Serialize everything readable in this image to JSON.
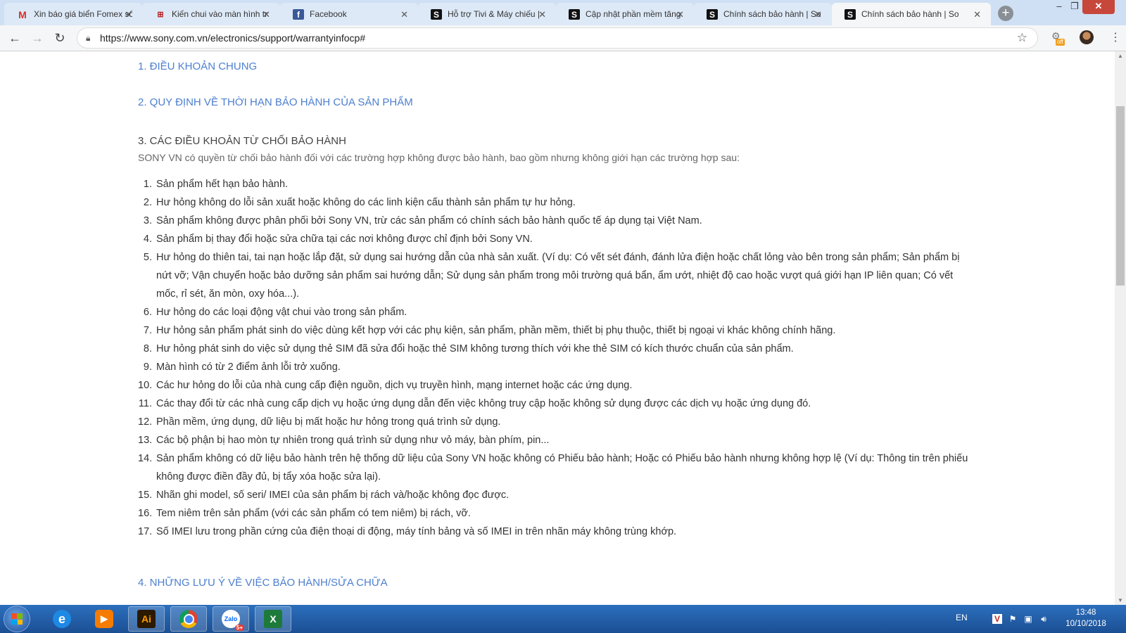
{
  "browser": {
    "tabs": [
      {
        "title": "Xin báo giá biển Fomex sổ",
        "favicon": "gmail-icon"
      },
      {
        "title": "Kiến chui vào màn hình tr",
        "favicon": "kienthuc-icon"
      },
      {
        "title": "Facebook",
        "favicon": "facebook-icon"
      },
      {
        "title": "Hỗ trợ Tivi & Máy chiếu |",
        "favicon": "sony-icon"
      },
      {
        "title": "Cập nhật phần mềm tăng",
        "favicon": "sony-icon"
      },
      {
        "title": "Chính sách bảo hành | So",
        "favicon": "sony-icon"
      },
      {
        "title": "Chính sách bảo hành | So",
        "favicon": "sony-icon",
        "active": true
      }
    ],
    "url": "https://www.sony.com.vn/electronics/support/warrantyinfocp#",
    "extension_badge": "off"
  },
  "page": {
    "section1": "1. ĐIỀU KHOẢN CHUNG",
    "section2": "2. QUY ĐỊNH VỀ THỜI HẠN BẢO HÀNH CỦA SẢN PHẨM",
    "section3": "3. CÁC ĐIỀU KHOẢN TỪ CHỐI BẢO HÀNH",
    "intro": "SONY VN có quyền từ chối bảo hành đối với các trường hợp không được bảo hành, bao gồm nhưng không giới hạn các trường hợp sau:",
    "items": [
      {
        "num": "1.",
        "text": "Sản phẩm hết hạn bảo hành."
      },
      {
        "num": "2.",
        "text": "Hư hỏng không do lỗi sản xuất hoặc không do các linh kiện cấu thành sản phẩm tự hư hỏng."
      },
      {
        "num": "3.",
        "text": "Sản phẩm không được phân phối bởi Sony VN, trừ các sản phẩm có chính sách bảo hành quốc tế áp dụng tại Việt Nam."
      },
      {
        "num": "4.",
        "text": "Sản phẩm bị thay đổi hoặc sửa chữa tại các nơi không được chỉ định bởi Sony VN."
      },
      {
        "num": "5.",
        "text": "Hư hỏng do thiên tai, tai nạn hoặc lắp đặt, sử dụng sai hướng dẫn của nhà sản xuất. (Ví dụ: Có vết sét đánh, đánh lửa điện hoặc chất lỏng vào bên trong sản phẩm; Sản phẩm bị nứt vỡ; Vận chuyển hoặc bảo dưỡng sản phẩm sai hướng dẫn; Sử dụng sản phẩm trong môi trường quá bẩn, ẩm ướt, nhiệt độ cao hoặc vượt quá giới hạn IP liên quan; Có vết mốc, rỉ sét, ăn mòn, oxy hóa...)."
      },
      {
        "num": "6.",
        "text": "Hư hỏng do các loại động vật chui vào trong sản phẩm."
      },
      {
        "num": "7.",
        "text": "Hư hỏng sản phẩm phát sinh do việc dùng kết hợp với các phụ kiện, sản phẩm, phần mềm, thiết bị phụ thuộc, thiết bị ngoại vi khác không chính hãng."
      },
      {
        "num": "8.",
        "text": "Hư hỏng phát sinh do việc sử dụng thẻ SIM đã sửa đổi hoặc thẻ SIM không tương thích với khe thẻ SIM có kích thước chuẩn của sản phẩm."
      },
      {
        "num": "9.",
        "text": "Màn hình có từ 2 điểm ảnh lỗi trở xuống."
      },
      {
        "num": "10.",
        "text": "Các hư hỏng do lỗi của nhà cung cấp điện nguồn, dịch vụ truyền hình, mạng internet hoặc các ứng dụng."
      },
      {
        "num": "11.",
        "text": "Các thay đổi từ các nhà cung cấp dịch vụ hoặc ứng dụng dẫn đến việc không truy cập hoặc không sử dụng được các dịch vụ hoặc ứng dụng đó."
      },
      {
        "num": "12.",
        "text": "Phần mềm, ứng dụng, dữ liệu bị mất hoặc hư hỏng trong quá trình sử dụng."
      },
      {
        "num": "13.",
        "text": "Các bộ phận bị hao mòn tự nhiên trong quá trình sử dụng như vỏ máy, bàn phím, pin..."
      },
      {
        "num": "14.",
        "text": "Sản phẩm không có dữ liệu bảo hành trên hệ thống dữ liệu của Sony VN hoặc không có Phiếu bảo hành; Hoặc có Phiếu bảo hành nhưng không hợp lệ (Ví dụ: Thông tin trên phiếu không được điền đầy đủ, bị tẩy xóa hoặc sửa lại)."
      },
      {
        "num": "15.",
        "text": "Nhãn ghi model, số seri/ IMEI của sản phẩm bị rách và/hoặc không đọc được."
      },
      {
        "num": "16.",
        "text": "Tem niêm trên sản phẩm (với các sản phẩm có tem niêm) bị rách, vỡ."
      },
      {
        "num": "17.",
        "text": "Số IMEI lưu trong phần cứng của điện thoại di động, máy tính bảng và số IMEI in trên nhãn máy không trùng khớp."
      }
    ],
    "section4": "4. NHỮNG LƯU Ý VỀ VIỆC BẢO HÀNH/SỬA CHỮA"
  },
  "taskbar": {
    "apps": [
      "internet-explorer",
      "media-player",
      "illustrator",
      "chrome",
      "zalo",
      "excel"
    ],
    "ai_label": "Ai",
    "zalo_label": "Zalo",
    "zalo_badge": "5+",
    "language": "EN",
    "time": "13:48",
    "date": "10/10/2018"
  },
  "colors": {
    "link": "#4d7fcf",
    "tab_strip": "#cfe0f4",
    "taskbar": "#1b4f93"
  }
}
